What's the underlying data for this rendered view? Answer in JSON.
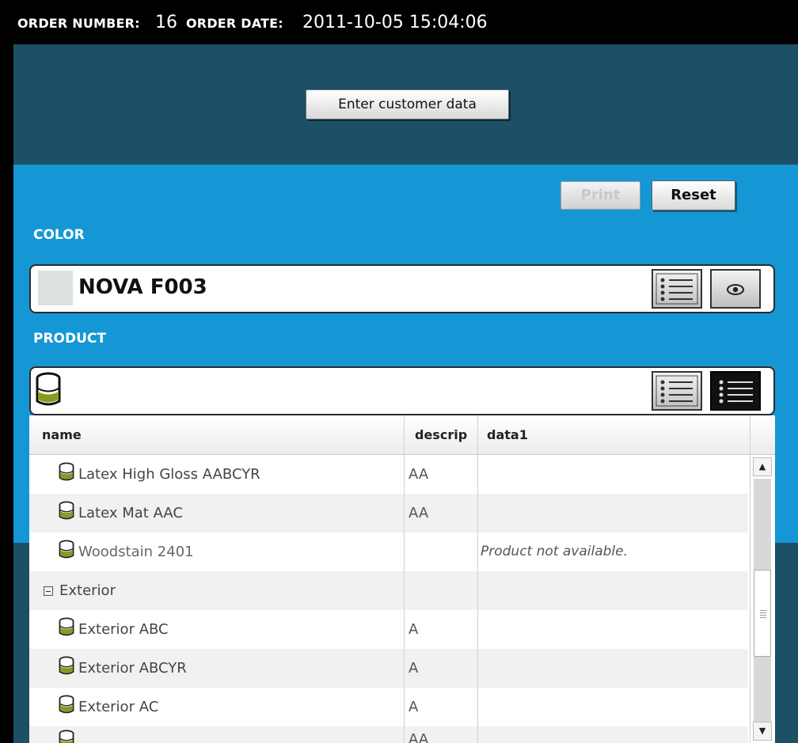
{
  "header": {
    "order_number_label": "ORDER NUMBER:",
    "order_number": "16",
    "order_date_label": "ORDER DATE:",
    "order_date": "2011-10-05 15:04:06"
  },
  "actions": {
    "enter_customer": "Enter customer data",
    "print": "Print",
    "reset": "Reset"
  },
  "color": {
    "label": "COLOR",
    "name": "NOVA F003",
    "swatch": "#dde2e1"
  },
  "product": {
    "label": "PRODUCT",
    "icon": "paint-can-icon"
  },
  "table": {
    "columns": [
      "name",
      "descrip",
      "data1"
    ],
    "rows": [
      {
        "name": "Latex High Gloss AABCYR",
        "descrip": "AA",
        "data1": "",
        "type": "item"
      },
      {
        "name": "Latex Mat AAC",
        "descrip": "AA",
        "data1": "",
        "type": "item"
      },
      {
        "name": "Woodstain 2401",
        "descrip": "",
        "data1": "Product not available.",
        "type": "item-muted"
      },
      {
        "name": "Exterior",
        "descrip": "",
        "data1": "",
        "type": "group"
      },
      {
        "name": "Exterior ABC",
        "descrip": "A",
        "data1": "",
        "type": "item"
      },
      {
        "name": "Exterior ABCYR",
        "descrip": "A",
        "data1": "",
        "type": "item"
      },
      {
        "name": "Exterior AC",
        "descrip": "A",
        "data1": "",
        "type": "item"
      },
      {
        "name": "",
        "descrip": "AA",
        "data1": "",
        "type": "item-partial"
      }
    ]
  },
  "colors": {
    "dark_band": "#1d4f66",
    "light_band": "#1597d6",
    "can_green": "#8a9a1e"
  }
}
